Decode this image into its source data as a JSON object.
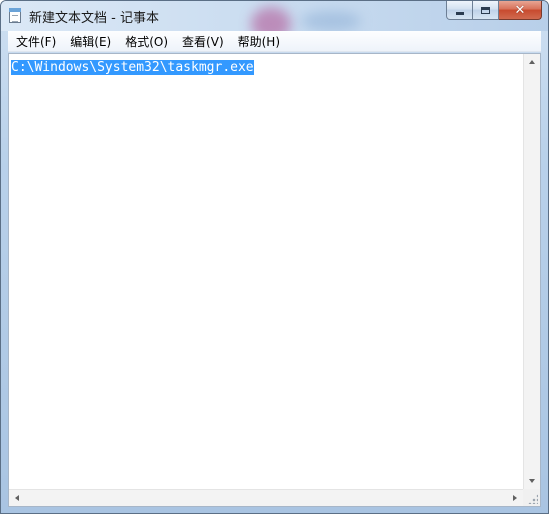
{
  "window": {
    "title": "新建文本文档 - 记事本",
    "icon": "notepad-icon"
  },
  "caption_buttons": {
    "minimize_icon": "minimize-icon",
    "maximize_icon": "maximize-icon",
    "close_icon": "close-icon",
    "close_glyph": "✕"
  },
  "menu": {
    "items": [
      {
        "label": "文件(F)"
      },
      {
        "label": "编辑(E)"
      },
      {
        "label": "格式(O)"
      },
      {
        "label": "查看(V)"
      },
      {
        "label": "帮助(H)"
      }
    ]
  },
  "editor": {
    "content": "C:\\Windows\\System32\\taskmgr.exe",
    "selected": true
  },
  "colors": {
    "selection_bg": "#3399ff",
    "selection_text": "#ffffff",
    "close_button": "#c74a2e"
  }
}
